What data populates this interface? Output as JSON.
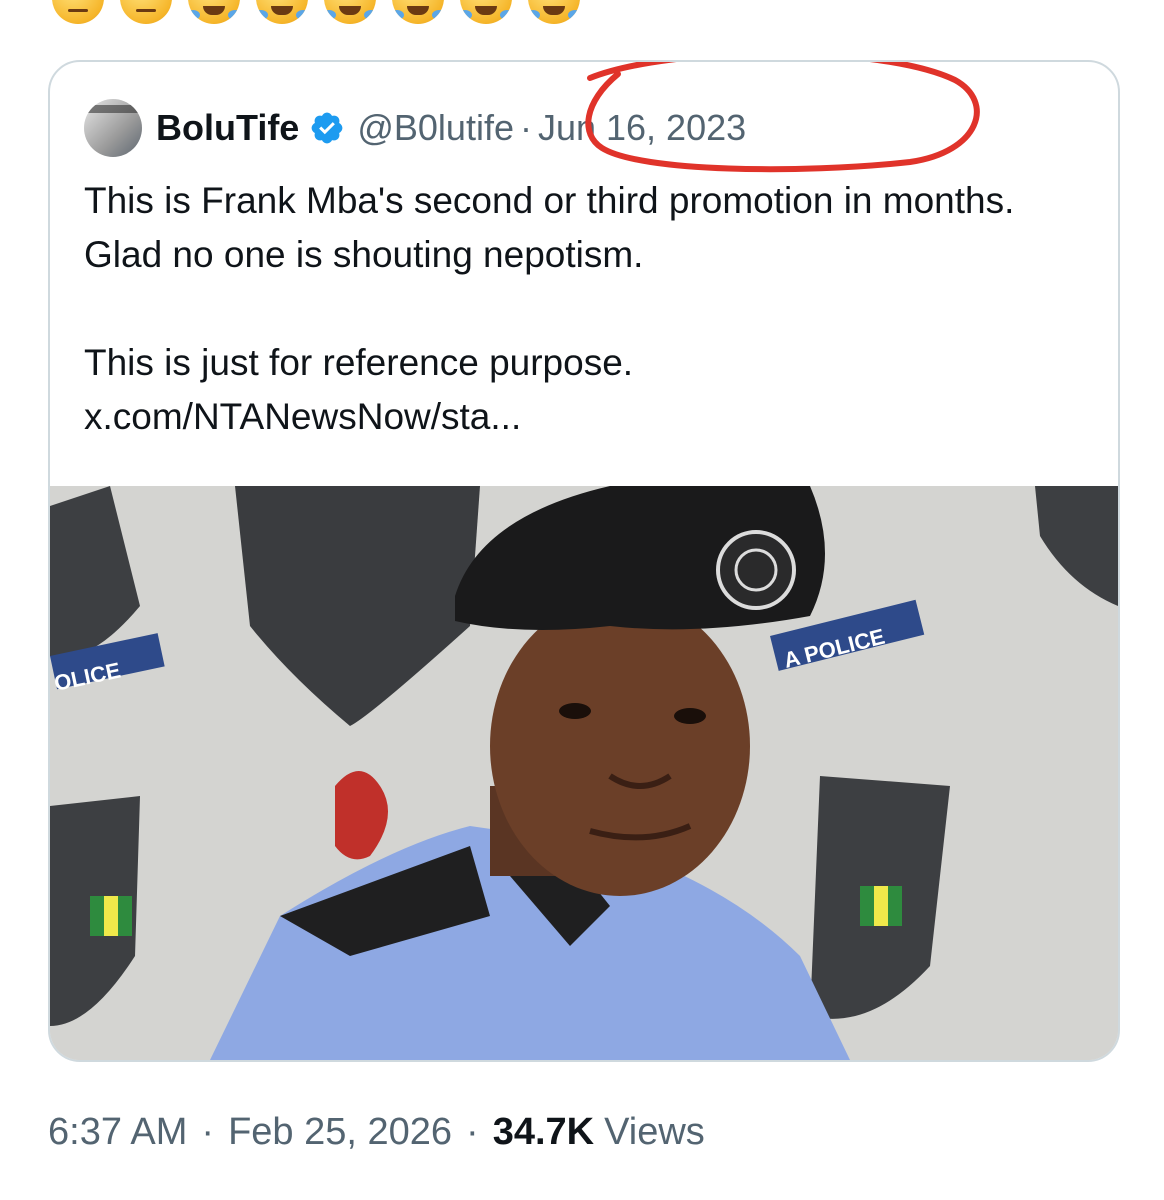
{
  "reaction_emojis": [
    "unamused-face",
    "unamused-face",
    "laughing-crying-face",
    "laughing-crying-face",
    "laughing-crying-face",
    "laughing-crying-face",
    "laughing-crying-face",
    "laughing-crying-face"
  ],
  "quoted_tweet": {
    "display_name": "BoluTife",
    "handle": "@B0lutife",
    "separator": "·",
    "date": "Jun 16, 2023",
    "verified": true,
    "text_line_1": "This is Frank Mba's second or third promotion in months. Glad no one is shouting nepotism.",
    "text_line_2": "This is just for reference purpose.",
    "link": "x.com/NTANewsNow/sta...",
    "image_description_icon": "photo-of-police-officer",
    "annotation_color": "#e0332a"
  },
  "footer": {
    "time": "6:37 AM",
    "separator": "·",
    "date": "Feb 25, 2026",
    "views_count": "34.7K",
    "views_label": "Views"
  },
  "colors": {
    "text": "#0f1419",
    "secondary": "#536471",
    "border": "#cfd9de",
    "verified_blue": "#1d9bf0"
  }
}
